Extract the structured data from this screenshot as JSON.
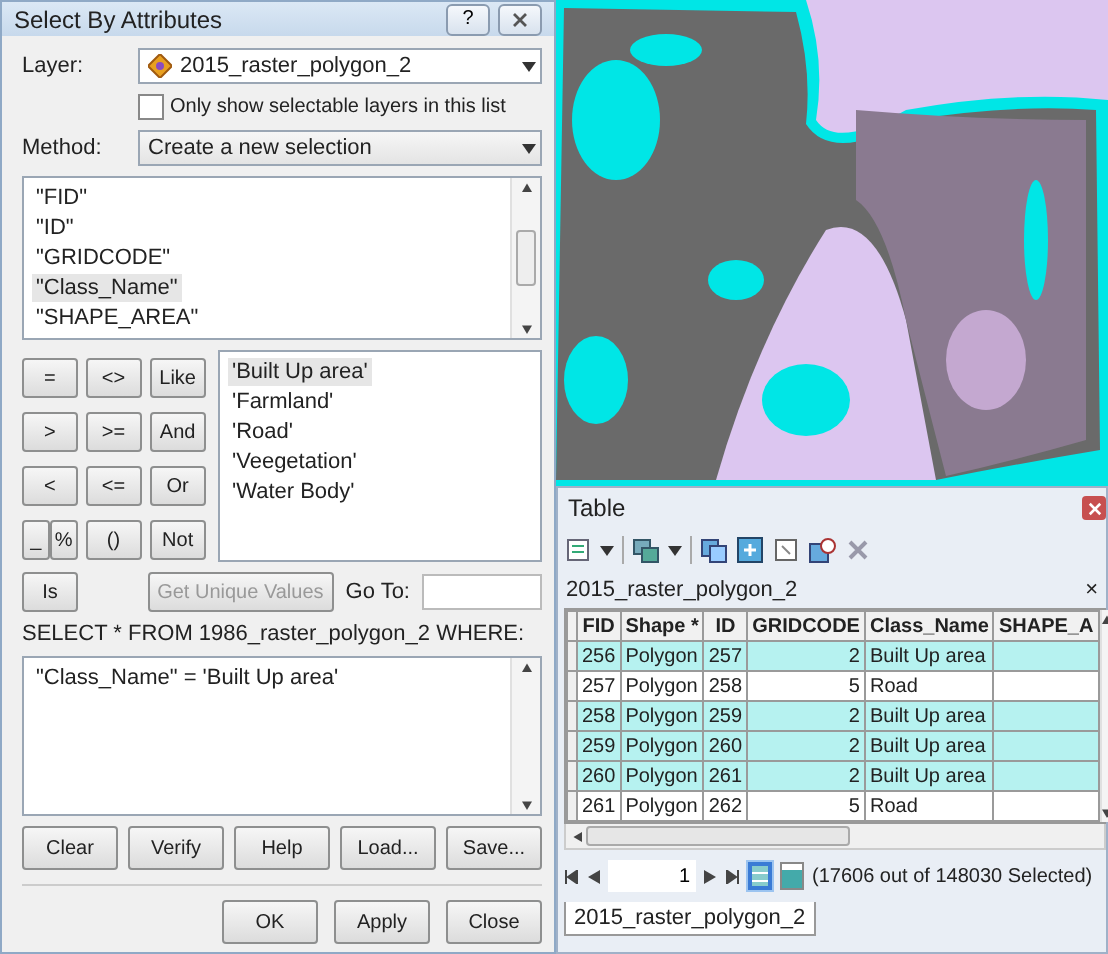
{
  "dialog": {
    "title": "Select By Attributes",
    "help_button": "?",
    "layer_label": "Layer:",
    "layer_value": "2015_raster_polygon_2",
    "selectable_only": {
      "label": "Only show selectable layers in this list",
      "checked": false
    },
    "method_label": "Method:",
    "method_value": "Create a new selection",
    "fields": [
      {
        "label": "\"FID\"",
        "selected": false
      },
      {
        "label": "\"ID\"",
        "selected": false
      },
      {
        "label": "\"GRIDCODE\"",
        "selected": false
      },
      {
        "label": "\"Class_Name\"",
        "selected": true
      },
      {
        "label": "\"SHAPE_AREA\"",
        "selected": false
      }
    ],
    "operators": [
      [
        "=",
        "<>",
        "Like"
      ],
      [
        ">",
        ">=",
        "And"
      ],
      [
        "<",
        "<=",
        "Or"
      ],
      [
        "_",
        "%",
        "()",
        "Not"
      ]
    ],
    "is_button": "Is",
    "values": [
      {
        "label": "'Built Up area'",
        "selected": true
      },
      {
        "label": "'Farmland'",
        "selected": false
      },
      {
        "label": "'Road'",
        "selected": false
      },
      {
        "label": "'Veegetation'",
        "selected": false
      },
      {
        "label": "'Water Body'",
        "selected": false
      }
    ],
    "unique_values_button": {
      "label": "Get Unique Values",
      "disabled": true
    },
    "goto_label": "Go To:",
    "query_label": "SELECT * FROM 1986_raster_polygon_2 WHERE:",
    "expression": "\"Class_Name\" = 'Built Up area'",
    "tool_buttons": [
      "Clear",
      "Verify",
      "Help",
      "Load...",
      "Save..."
    ],
    "buttons": [
      "OK",
      "Apply",
      "Close"
    ]
  },
  "table": {
    "title": "Table",
    "tab": {
      "label": "2015_raster_polygon_2",
      "close": "×"
    },
    "columns": [
      "FID",
      "Shape *",
      "ID",
      "GRIDCODE",
      "Class_Name",
      "SHAPE_A"
    ],
    "rows": [
      {
        "cells": [
          "256",
          "Polygon",
          "257",
          "2",
          "Built Up area"
        ],
        "selected": true
      },
      {
        "cells": [
          "257",
          "Polygon",
          "258",
          "5",
          "Road"
        ],
        "selected": false
      },
      {
        "cells": [
          "258",
          "Polygon",
          "259",
          "2",
          "Built Up area"
        ],
        "selected": true
      },
      {
        "cells": [
          "259",
          "Polygon",
          "260",
          "2",
          "Built Up area"
        ],
        "selected": true
      },
      {
        "cells": [
          "260",
          "Polygon",
          "261",
          "2",
          "Built Up area"
        ],
        "selected": true
      },
      {
        "cells": [
          "261",
          "Polygon",
          "262",
          "5",
          "Road"
        ],
        "selected": false
      }
    ],
    "record": "1",
    "views": [
      {
        "selected": true
      },
      {
        "selected": false
      }
    ],
    "status": "(17606 out of 148030 Selected)",
    "bottom_tab": "2015_raster_polygon_2"
  }
}
